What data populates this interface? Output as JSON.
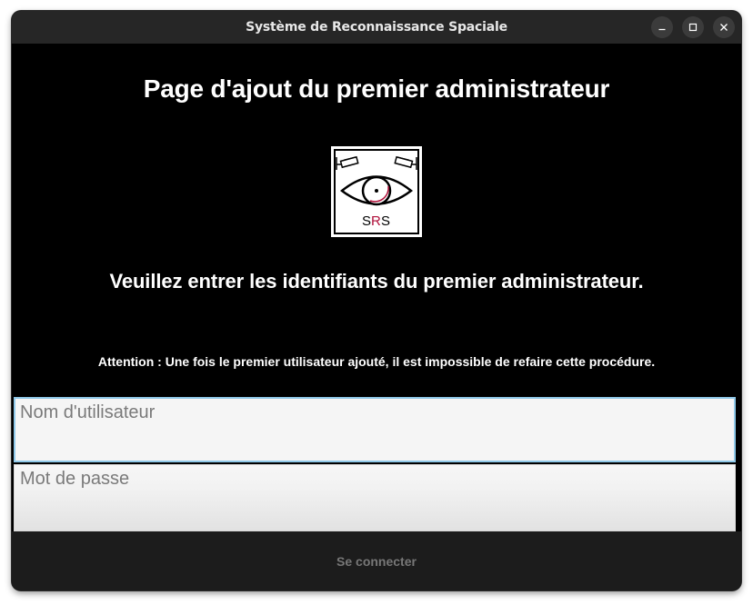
{
  "window": {
    "title": "Système de Reconnaissance Spaciale"
  },
  "header": {
    "page_title": "Page d'ajout du premier administrateur"
  },
  "logo": {
    "text": "SRS",
    "icon": "surveillance-eye-logo"
  },
  "main": {
    "instruction": "Veuillez entrer les identifiants du premier administrateur.",
    "warning": "Attention : Une fois le premier utilisateur ajouté, il est impossible de refaire cette procédure."
  },
  "form": {
    "username_placeholder": "Nom d'utilisateur",
    "username_value": "",
    "password_placeholder": "Mot de passe",
    "password_value": "",
    "submit_label": "Se connecter"
  },
  "colors": {
    "background": "#000000",
    "titlebar": "#262626",
    "focus_border": "#8fc8e8",
    "button_bg": "#1c1c1c",
    "button_text": "#777777"
  }
}
